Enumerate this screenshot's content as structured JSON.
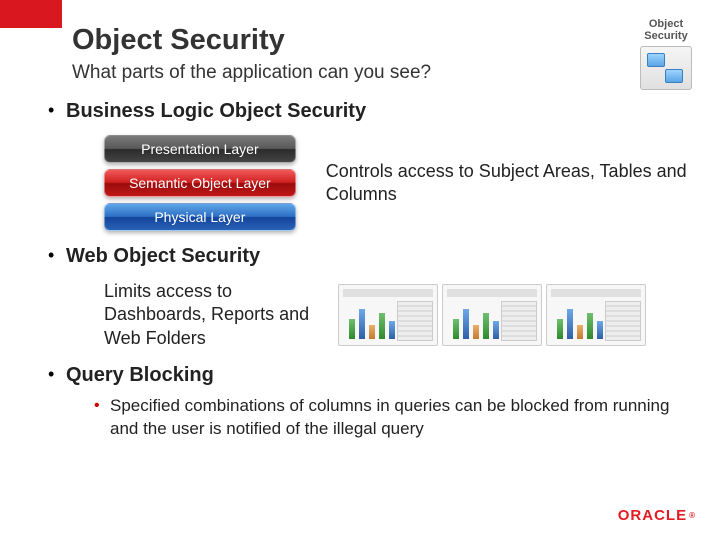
{
  "header": {
    "title": "Object Security",
    "subtitle": "What parts of the application can you see?"
  },
  "corner_icon": {
    "label_line1": "Object",
    "label_line2": "Security"
  },
  "sections": [
    {
      "heading": "Business Logic Object Security",
      "layers": [
        {
          "label": "Presentation Layer",
          "style": "grey"
        },
        {
          "label": "Semantic Object Layer",
          "style": "red"
        },
        {
          "label": "Physical Layer",
          "style": "blue"
        }
      ],
      "description": "Controls access to Subject Areas, Tables and Columns"
    },
    {
      "heading": "Web Object Security",
      "description": "Limits access to Dashboards, Reports and Web Folders"
    },
    {
      "heading": "Query Blocking",
      "sub_bullet": "Specified combinations of columns in queries can be blocked from running and the user is notified of the illegal query"
    }
  ],
  "footer": {
    "logo_text": "ORACLE"
  }
}
